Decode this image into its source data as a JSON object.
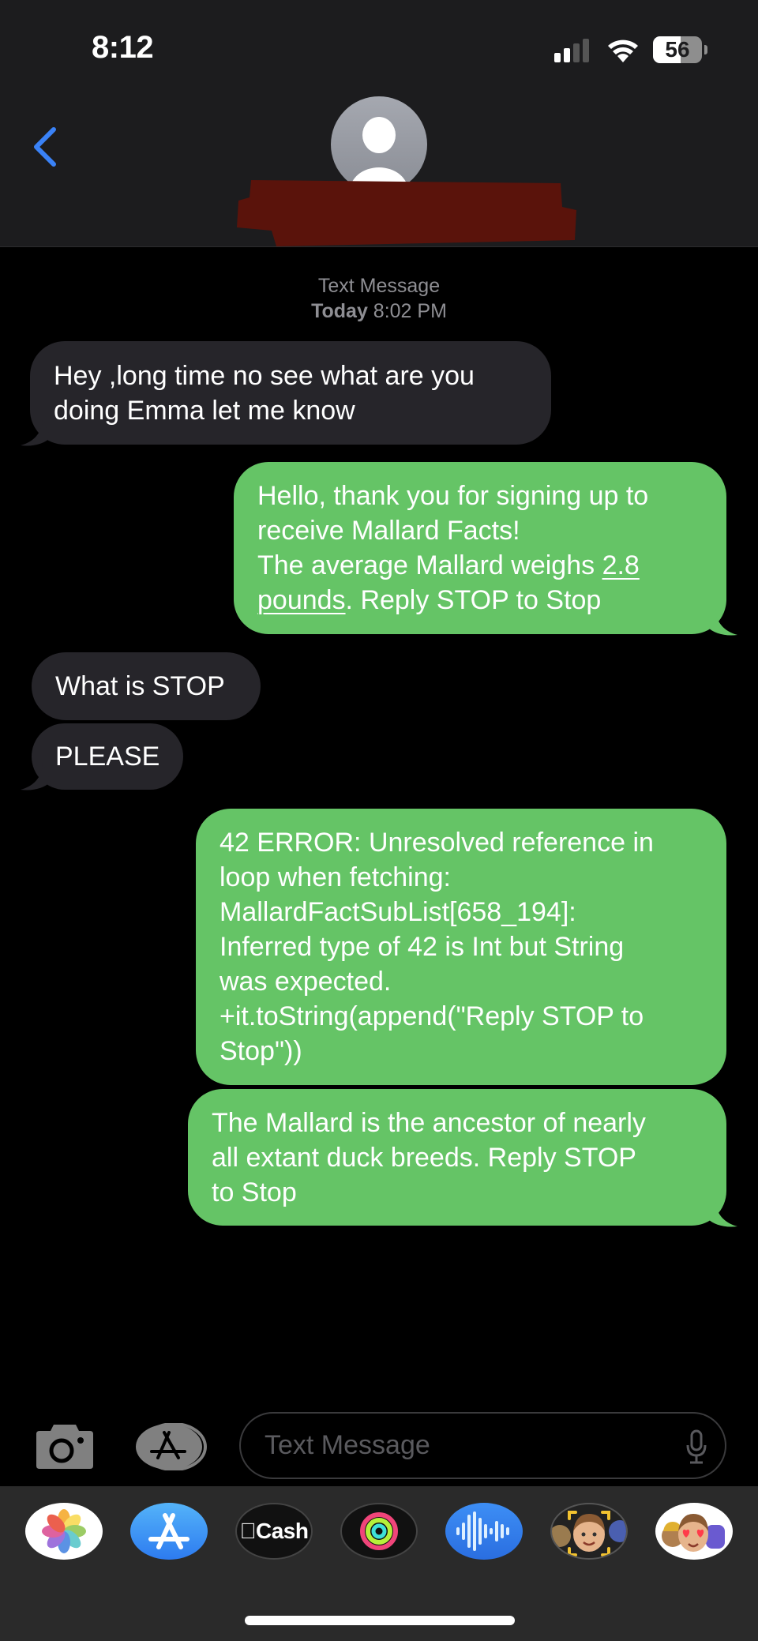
{
  "status_bar": {
    "time": "8:12",
    "signal_bars_lit": 2,
    "signal_bars_total": 4,
    "battery_level": "56",
    "battery_fraction": 0.56
  },
  "header": {
    "back_label": "Back",
    "contact_name": "[redacted]"
  },
  "thread": {
    "service_label": "Text Message",
    "date_label": "Today",
    "time_label": "8:02 PM",
    "messages": [
      {
        "direction": "incoming",
        "text": "Hey ,long time no see what are you\ndoing Emma let me know"
      },
      {
        "direction": "outgoing",
        "text_parts": [
          "Hello, thank you for signing up to\nreceive Mallard Facts!\nThe average Mallard weighs ",
          "2.8\npounds",
          ". Reply STOP to Stop"
        ]
      },
      {
        "direction": "incoming",
        "text": "What is STOP"
      },
      {
        "direction": "incoming",
        "text": "PLEASE"
      },
      {
        "direction": "outgoing",
        "text": "42 ERROR: Unresolved reference in\nloop when fetching:\nMallardFactSubList[658_194]:\nInferred type of 42 is Int but String\nwas expected.\n+it.toString(append(\"Reply STOP to\nStop\"))"
      },
      {
        "direction": "outgoing",
        "text": "The Mallard is the ancestor of nearly\nall extant duck breeds. Reply STOP\nto Stop"
      }
    ]
  },
  "compose": {
    "placeholder": "Text Message",
    "value": ""
  },
  "app_drawer": {
    "apps": [
      {
        "name": "Photos",
        "icon": "photos-icon"
      },
      {
        "name": "App Store",
        "icon": "app-store-icon"
      },
      {
        "name": "Apple Cash",
        "label": "Cash",
        "icon": "apple-cash-icon"
      },
      {
        "name": "Activity",
        "icon": "activity-rings-icon"
      },
      {
        "name": "Audio Message",
        "icon": "waveform-icon"
      },
      {
        "name": "Memoji",
        "icon": "memoji-icon"
      },
      {
        "name": "Memoji Stickers",
        "icon": "memoji-stickers-icon"
      }
    ]
  },
  "colors": {
    "accent_blue": "#3a82f7",
    "outgoing_bubble": "#65c466",
    "incoming_bubble": "#26252a",
    "header_bg": "#1c1c1e",
    "redaction": "#5a130b"
  }
}
